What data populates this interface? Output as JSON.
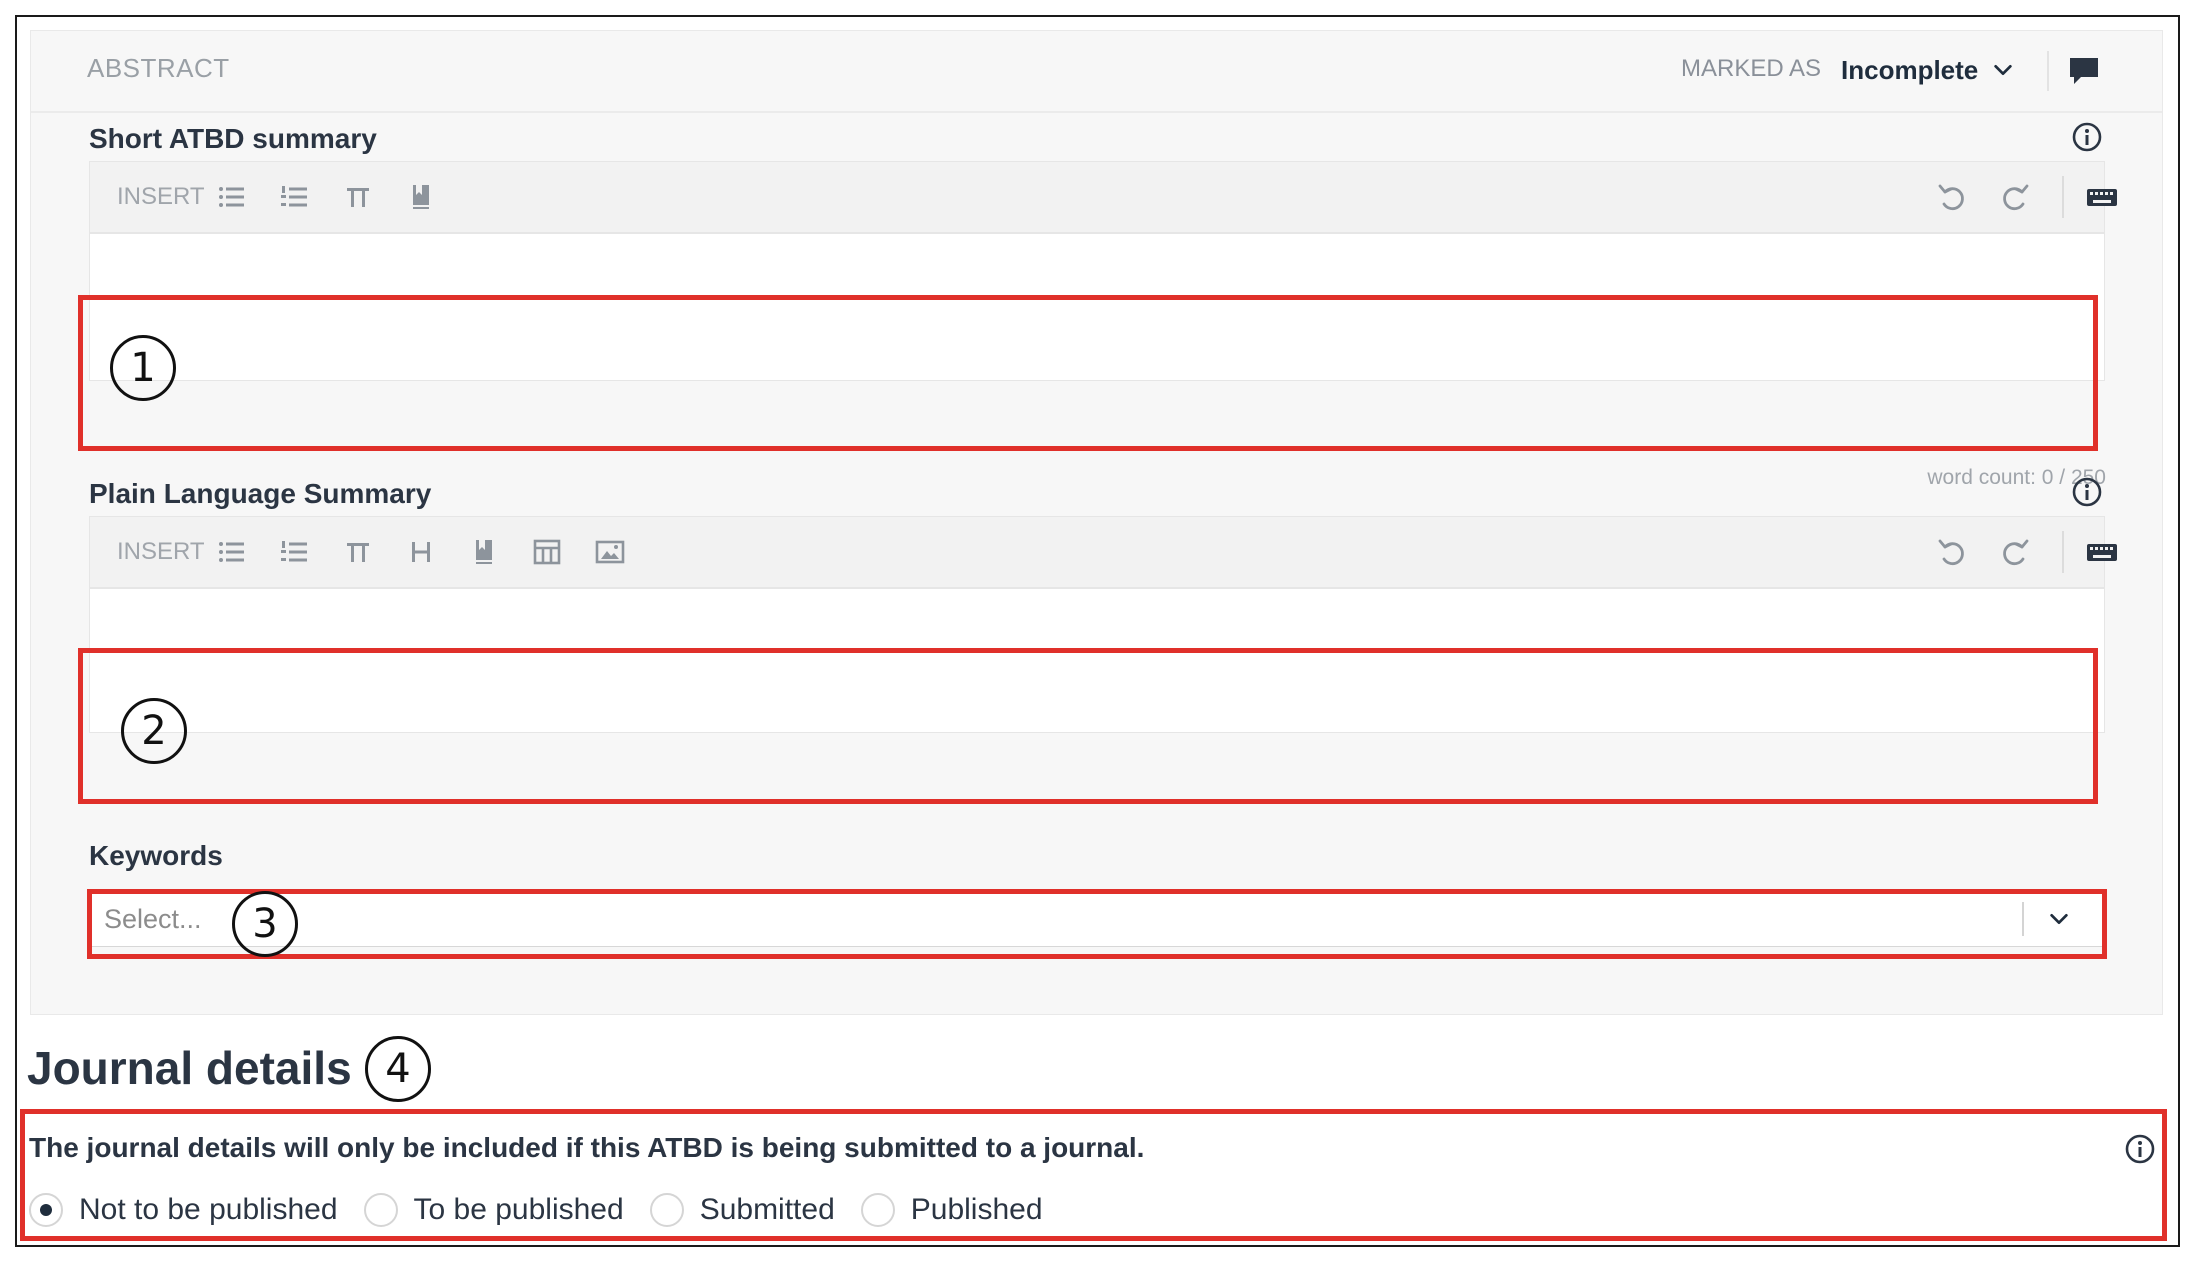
{
  "abstract": {
    "section_label": "ABSTRACT",
    "marked_as_label": "MARKED AS",
    "status_value": "Incomplete"
  },
  "short_summary": {
    "label": "Short ATBD summary",
    "toolbar_insert": "INSERT",
    "word_count": "word count: 0 / 250"
  },
  "plain_summary": {
    "label": "Plain Language Summary",
    "toolbar_insert": "INSERT"
  },
  "keywords": {
    "label": "Keywords",
    "placeholder": "Select..."
  },
  "journal": {
    "title": "Journal details",
    "note": "The journal details will only be included if this ATBD is being submitted to a journal.",
    "options": [
      "Not to be published",
      "To be published",
      "Submitted",
      "Published"
    ],
    "selected": "Not to be published"
  },
  "callouts": [
    "1",
    "2",
    "3",
    "4"
  ],
  "colors": {
    "highlight": "#e0302a",
    "card_background": "#f7f7f7",
    "text_dark": "#2b3543",
    "text_muted": "#9aa0a6"
  },
  "icons": {
    "toolbar_short": [
      "bullet-list-icon",
      "numbered-list-icon",
      "pi-icon",
      "bookmark-icon"
    ],
    "toolbar_plain": [
      "bullet-list-icon",
      "numbered-list-icon",
      "pi-icon",
      "heading-icon",
      "bookmark-icon",
      "table-icon",
      "image-icon"
    ],
    "toolbar_right": [
      "undo-icon",
      "redo-icon",
      "keyboard-icon"
    ],
    "header": [
      "chevron-down-icon",
      "comment-icon"
    ]
  }
}
